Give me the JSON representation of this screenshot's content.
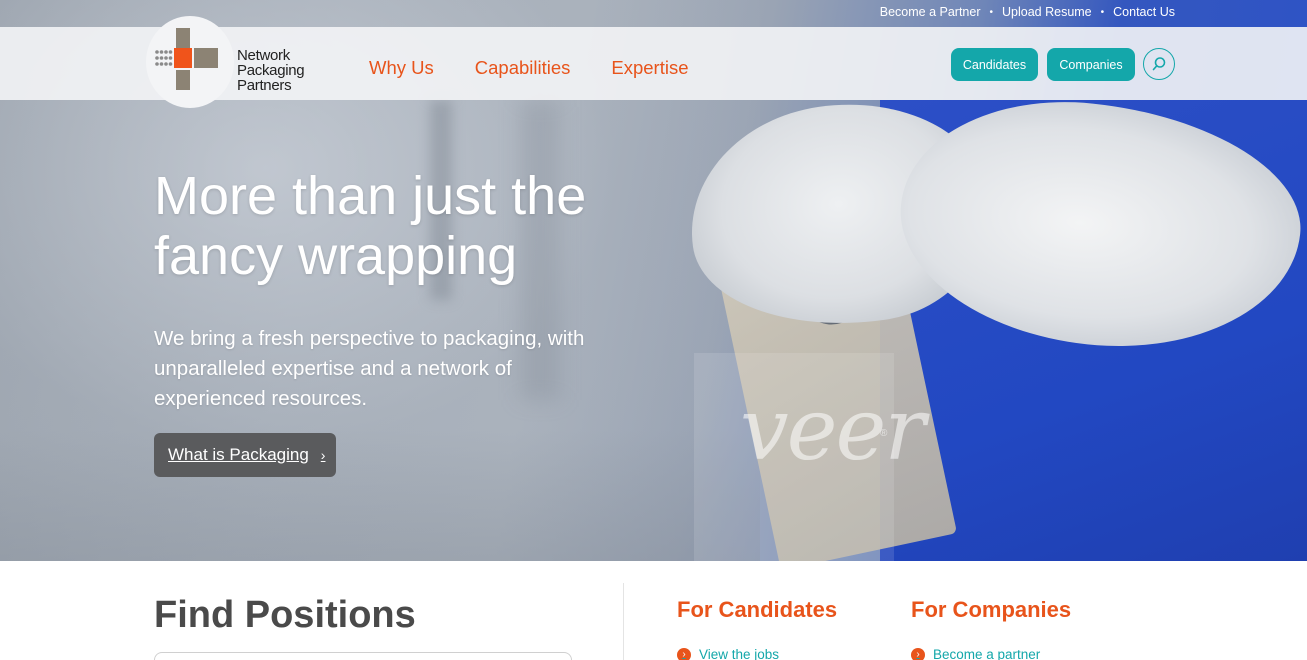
{
  "utility_nav": {
    "items": [
      "Become a Partner",
      "Upload Resume",
      "Contact Us"
    ],
    "separator": "•"
  },
  "brand": {
    "line1": "Network",
    "line2": "Packaging",
    "line3": "Partners"
  },
  "main_nav": {
    "items": [
      "Why Us",
      "Capabilities",
      "Expertise"
    ]
  },
  "header_actions": {
    "candidates_label": "Candidates",
    "companies_label": "Companies",
    "search_icon": "search-icon"
  },
  "hero": {
    "title": "More than just the fancy wrapping",
    "subtitle": "We bring a fresh perspective to packaging, with unparalleled expertise and a network of experienced resources.",
    "cta_label": "What is Packaging",
    "cta_chevron": "›",
    "watermark": "veer",
    "watermark_mark": "®"
  },
  "find_positions": {
    "title": "Find Positions"
  },
  "for_candidates": {
    "title": "For Candidates",
    "link": "View the jobs"
  },
  "for_companies": {
    "title": "For Companies",
    "link": "Become a partner"
  },
  "colors": {
    "accent_orange": "#e8541b",
    "accent_teal": "#14a7aa",
    "hero_button": "#5a5b5d"
  }
}
